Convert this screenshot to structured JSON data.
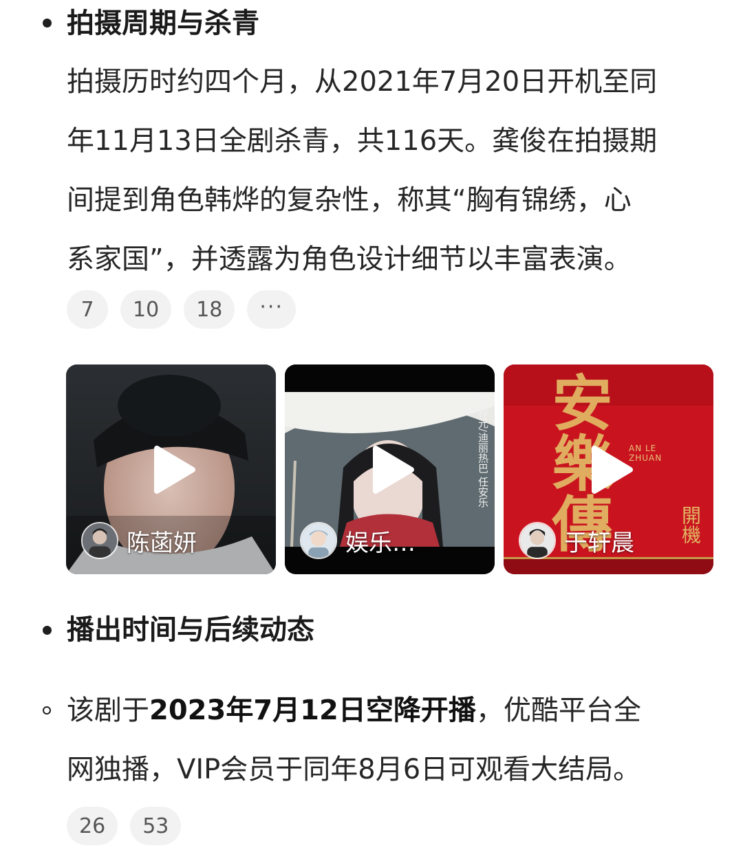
{
  "section1": {
    "heading": "拍摄周期与杀青",
    "lines": [
      "拍摄历时约四个月，从2021年7月20日开机至同",
      "年11月13日全剧杀青，共116天。龚俊在拍摄期",
      "间提到角色韩烨的复杂性，称其“胸有锦绣，心",
      "系家国”，并透露为角色设计细节以丰富表演。"
    ],
    "chips": [
      "7",
      "10",
      "18",
      "···"
    ]
  },
  "videos": [
    {
      "name": "陈菡妍",
      "icon": "play-icon"
    },
    {
      "name": "娱乐…",
      "icon": "play-icon",
      "overlay": {
        "col1": "帝梓元/迪丽热巴",
        "col2": "任安乐"
      }
    },
    {
      "name": "于轩晨",
      "icon": "play-icon",
      "overlay": {
        "title": "安樂傳",
        "latin": "AN LE ZHUAN",
        "side": "開機"
      }
    }
  ],
  "section2": {
    "heading": "播出时间与后续动态",
    "line1_pre": "该剧于",
    "line1_bold": "2023年7月12日空降开播",
    "line1_post": "，优酷平台全",
    "line2": "网独播，VIP会员于同年8月6日可观看大结局。",
    "chips": [
      "26",
      "53"
    ]
  }
}
